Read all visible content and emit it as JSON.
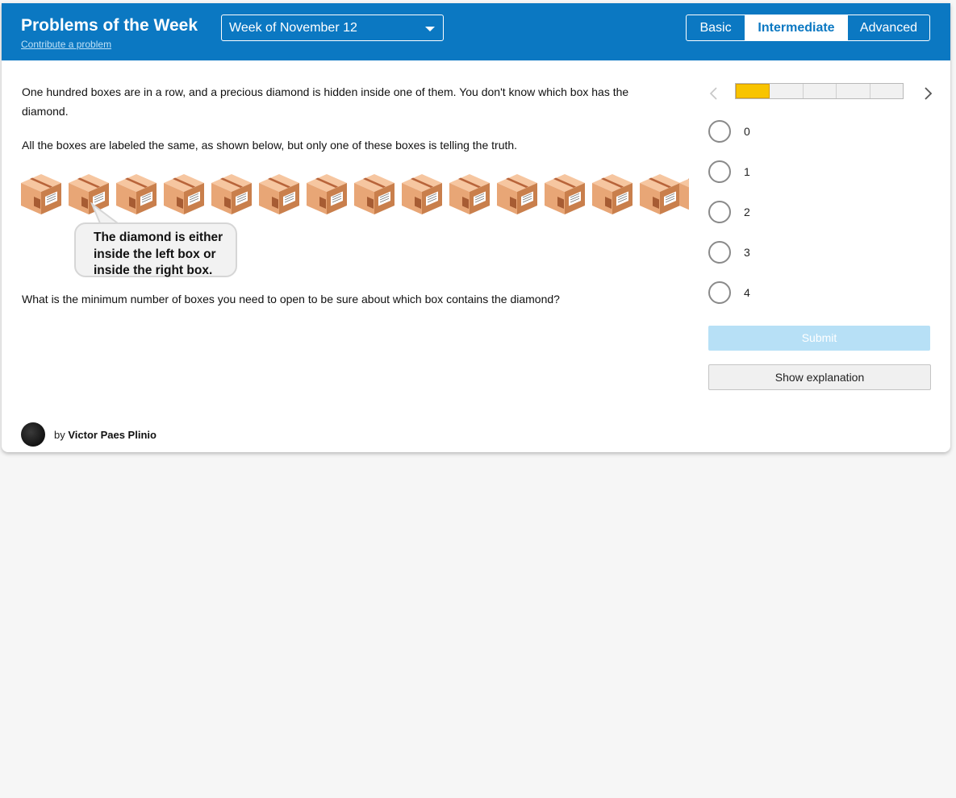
{
  "header": {
    "title": "Problems of the Week",
    "contribute_link": "Contribute a problem",
    "week_select": {
      "selected": "Week of November 12"
    },
    "levels": [
      "Basic",
      "Intermediate",
      "Advanced"
    ],
    "active_level": "Intermediate",
    "background_color": "#0b78c2"
  },
  "problem": {
    "paragraph1": "One hundred boxes are in a row, and a precious diamond is hidden inside one of them. You don't know which box has the diamond.",
    "paragraph2": "All the boxes are labeled the same, as shown below, but only one of these boxes is telling the truth.",
    "box_label_lines": [
      "The diamond is either",
      "inside the left box or",
      "inside the right box."
    ],
    "question": "What is the minimum number of boxes you need to open to be sure about which box contains the diamond?"
  },
  "progress": {
    "completed": 1,
    "total": 5,
    "fill_color": "#f8c400"
  },
  "options": [
    "0",
    "1",
    "2",
    "3",
    "4"
  ],
  "buttons": {
    "submit": "Submit",
    "show_explanation": "Show explanation"
  },
  "author": {
    "prefix": "by",
    "name": "Victor Paes Plinio"
  }
}
